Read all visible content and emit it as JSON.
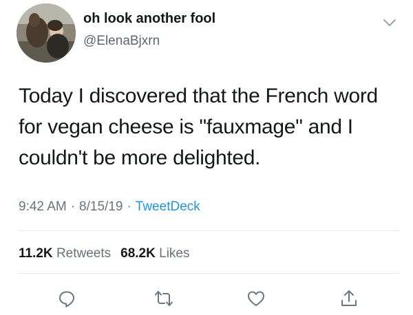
{
  "tweet": {
    "display_name": "oh look another fool",
    "handle": "@ElenaBjxrn",
    "text_lines": [
      "Today I discovered that the French word",
      "for vegan cheese is \"fauxmage\" and I",
      "couldn't be more delighted."
    ],
    "time": "9:42 AM",
    "date": "8/15/19",
    "separator": "·",
    "source": "TweetDeck",
    "retweets_count": "11.2K",
    "retweets_label": "Retweets",
    "likes_count": "68.2K",
    "likes_label": "Likes"
  },
  "icons": {
    "caret": "chevron-down-icon",
    "reply": "reply-icon",
    "retweet": "retweet-icon",
    "like": "heart-icon",
    "share": "share-icon"
  },
  "colors": {
    "text": "#14171a",
    "secondary": "#65737e",
    "link": "#1b95e0",
    "divider": "#e1e8ed",
    "icon": "#657786"
  }
}
